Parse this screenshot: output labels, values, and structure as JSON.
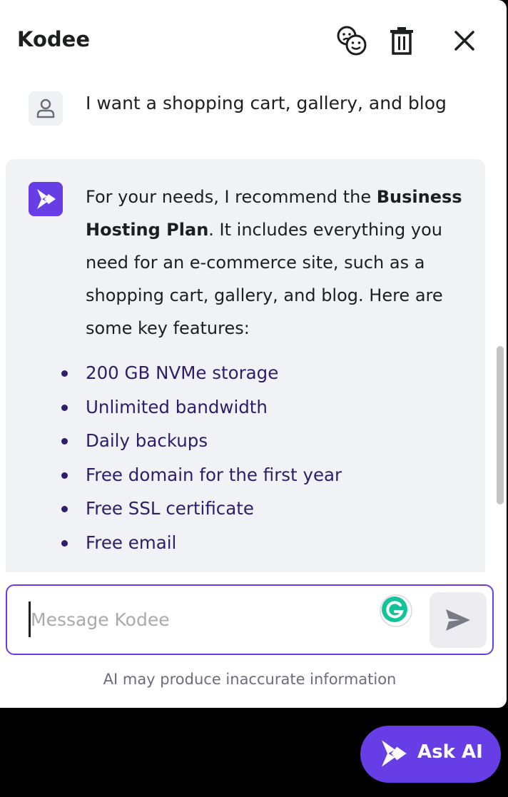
{
  "colors": {
    "accent": "#673de6",
    "text": "#1d1e20",
    "list_text": "#2f1c6a",
    "bot_bubble": "#f1f2f6",
    "muted": "#6d6d7a"
  },
  "header": {
    "title": "Kodee",
    "icons": [
      "feedback-faces-icon",
      "trash-icon",
      "close-icon"
    ]
  },
  "chat": {
    "user_message": "I want a shopping cart, gallery, and blog",
    "bot_message": {
      "intro": "For your needs, I recommend the ",
      "plan_name": "Business Hosting Plan",
      "body": ". It includes everything you need for an e-commerce site, such as a shopping cart, gallery, and blog. Here are some key features:",
      "features": [
        "200 GB NVMe storage",
        "Unlimited bandwidth",
        "Daily backups",
        "Free domain for the first year",
        "Free SSL certificate",
        "Free email"
      ]
    }
  },
  "composer": {
    "placeholder": "Message Kodee",
    "value": ""
  },
  "disclaimer": "AI may produce inaccurate information",
  "ask_ai": {
    "label": "Ask AI"
  }
}
